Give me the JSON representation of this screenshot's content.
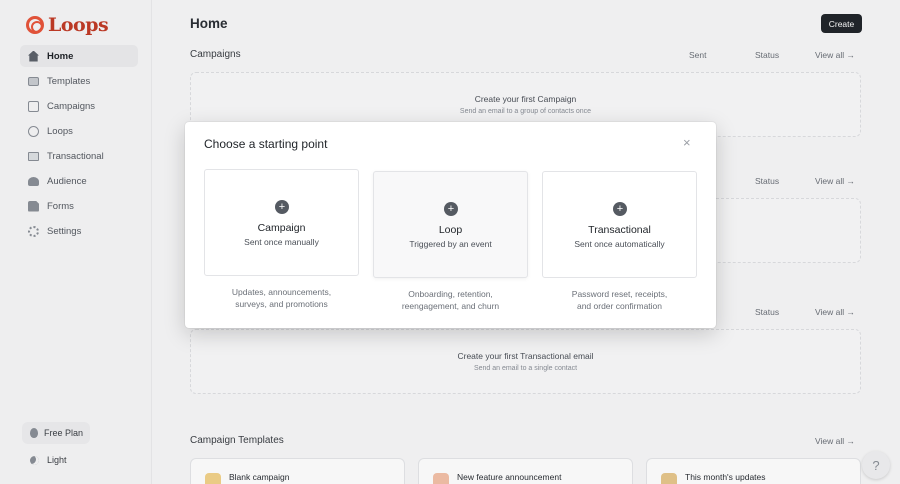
{
  "brand": {
    "name": "Loops"
  },
  "sidebar": {
    "items": [
      {
        "label": "Home",
        "icon": "home-icon"
      },
      {
        "label": "Templates",
        "icon": "templates-icon"
      },
      {
        "label": "Campaigns",
        "icon": "edit-icon"
      },
      {
        "label": "Loops",
        "icon": "loop-icon"
      },
      {
        "label": "Transactional",
        "icon": "mail-icon"
      },
      {
        "label": "Audience",
        "icon": "users-icon"
      },
      {
        "label": "Forms",
        "icon": "forms-icon"
      },
      {
        "label": "Settings",
        "icon": "gear-icon"
      }
    ],
    "plan_label": "Free Plan",
    "theme_label": "Light"
  },
  "header": {
    "title": "Home",
    "create_label": "Create"
  },
  "sections": {
    "campaigns": {
      "title": "Campaigns",
      "col_sent": "Sent",
      "col_status": "Status",
      "view_all": "View all →",
      "empty_title": "Create your first Campaign",
      "empty_sub": "Send an email to a group of contacts once"
    },
    "loops": {
      "col_status": "Status",
      "view_all": "View all →"
    },
    "transactional": {
      "col_status": "Status",
      "view_all": "View all →",
      "empty_title": "Create your first Transactional email",
      "empty_sub": "Send an email to a single contact"
    },
    "templates": {
      "title": "Campaign Templates",
      "view_all": "View all →",
      "items": [
        {
          "label": "Blank campaign"
        },
        {
          "label": "New feature announcement"
        },
        {
          "label": "This month's updates"
        }
      ]
    }
  },
  "modal": {
    "title": "Choose a starting point",
    "close": "×",
    "options": [
      {
        "name": "Campaign",
        "sub": "Sent once manually",
        "desc_1": "Updates, announcements,",
        "desc_2": "surveys, and promotions"
      },
      {
        "name": "Loop",
        "sub": "Triggered by an event",
        "desc_1": "Onboarding, retention,",
        "desc_2": "reengagement, and churn"
      },
      {
        "name": "Transactional",
        "sub": "Sent once automatically",
        "desc_1": "Password reset, receipts,",
        "desc_2": "and order confirmation"
      }
    ]
  },
  "help": {
    "label": "?"
  },
  "colors": {
    "accent": "#e8553b",
    "button_dark": "#22262b"
  }
}
